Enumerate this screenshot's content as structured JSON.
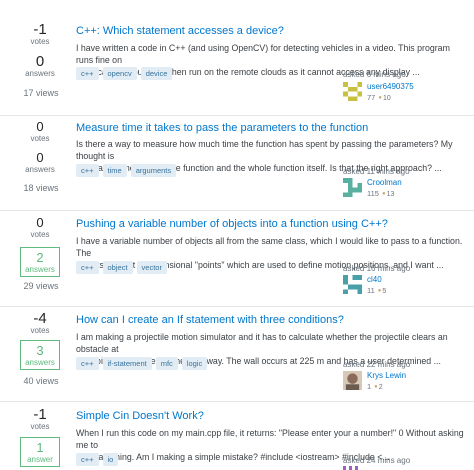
{
  "questions": [
    {
      "votes": "-1",
      "votes_label": "votes",
      "answers": "0",
      "answers_label": "answers",
      "answers_accepted": false,
      "views": "17 views",
      "title": "C++: Which statement accesses a device?",
      "excerpt_lines": [
        "I have written a code in C++ (and using OpenCV) for detecting vehicles in a video. This program runs fine on",
        "the local host, but fails when run on the remote clouds as it cannot access any display ..."
      ],
      "tags": [
        "c++",
        "opencv",
        "device"
      ],
      "asked": "asked 6 mins ago",
      "user": "user6490375",
      "rep": "77",
      "badges": [
        {
          "type": "bronze",
          "count": "10"
        }
      ],
      "avatar_color": "#c8c040"
    },
    {
      "votes": "0",
      "votes_label": "votes",
      "answers": "0",
      "answers_label": "answers",
      "answers_accepted": false,
      "views": "18 views",
      "title": "Measure time it takes to pass the parameters to the function",
      "excerpt_lines": [
        "Is there a way to measure how much time the function has spent by passing the parameters? My thought is",
        "to measure the body of the function and the whole function itself. Is that the right approach? ..."
      ],
      "tags": [
        "c++",
        "time",
        "arguments"
      ],
      "asked": "asked 11 mins ago",
      "user": "Croolman",
      "rep": "115",
      "badges": [
        {
          "type": "bronze",
          "count": "13"
        }
      ],
      "avatar_color": "#5ab0a0"
    },
    {
      "votes": "0",
      "votes_label": "votes",
      "answers": "2",
      "answers_label": "answers",
      "answers_accepted": true,
      "views": "29 views",
      "title": "Pushing a variable number of objects into a function using C++?",
      "excerpt_lines": [
        "I have a variable number of objects all from the same class, which I would like to pass to a function. The",
        "objects are just 8-dimensional \"points\" which are used to define motion positions, and I want ..."
      ],
      "tags": [
        "c++",
        "object",
        "vector"
      ],
      "asked": "asked 16 mins ago",
      "user": "cl40",
      "rep": "11",
      "badges": [
        {
          "type": "bronze",
          "count": "5"
        }
      ],
      "avatar_color": "#4aa0a8"
    },
    {
      "votes": "-4",
      "votes_label": "votes",
      "answers": "3",
      "answers_label": "answers",
      "answers_accepted": true,
      "views": "40 views",
      "title": "How can I create an If statement with three conditions?",
      "excerpt_lines": [
        "I am making a projectile motion simulator and it has to calculate whether the projectile clears an obstacle at",
        "an arbitrary distance and height away. The wall occurs at 225 m and has a user determined ..."
      ],
      "tags": [
        "c++",
        "if-statement",
        "mfc",
        "logic"
      ],
      "asked": "asked 22 mins ago",
      "user": "Krys Lewin",
      "rep": "1",
      "badges": [
        {
          "type": "bronze",
          "count": "2"
        }
      ],
      "avatar_color": "#8a6a5a"
    },
    {
      "votes": "-1",
      "votes_label": "votes",
      "answers": "1",
      "answers_label": "answer",
      "answers_accepted": true,
      "views": "",
      "title": "Simple Cin Doesn't Work?",
      "excerpt_lines": [
        "When I run this code on my main.cpp file, it returns: \"Please enter your a number!\" 0 Without asking me to",
        "enter anything. Am I making a simple mistake? #include <iostream> #include <..."
      ],
      "tags": [
        "c++",
        "io"
      ],
      "asked": "asked 24 mins ago",
      "user": "",
      "rep": "",
      "badges": [],
      "avatar_color": "#a060c0"
    }
  ]
}
